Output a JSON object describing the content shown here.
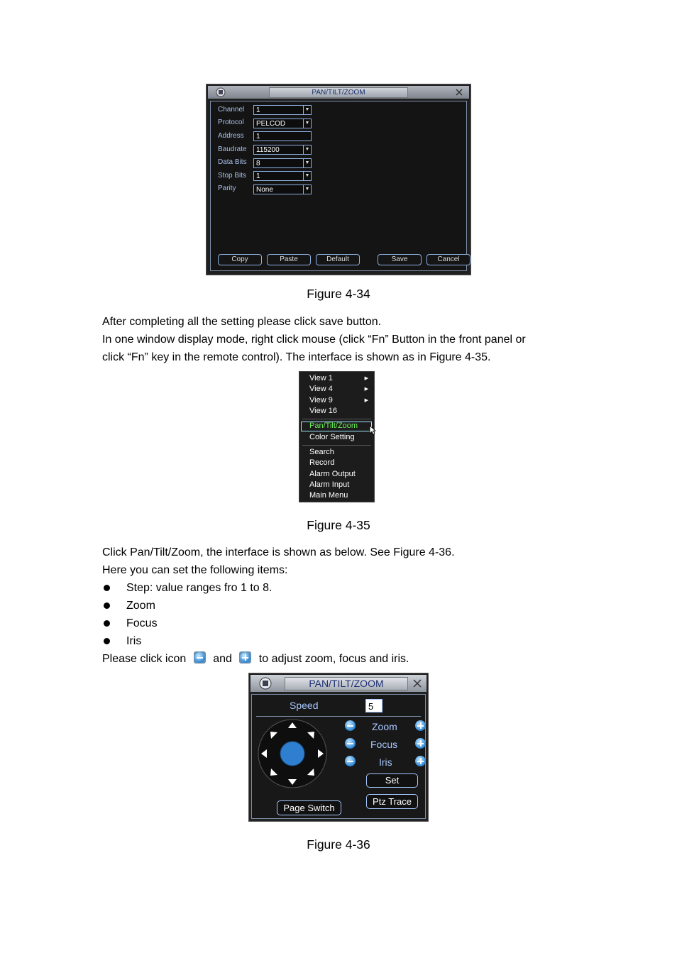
{
  "figure1": {
    "title": "PAN/TILT/ZOOM",
    "fields": [
      {
        "label": "Channel",
        "value": "1",
        "dropdown": true
      },
      {
        "label": "Protocol",
        "value": "PELCOD",
        "dropdown": true
      },
      {
        "label": "Address",
        "value": "1",
        "dropdown": false
      },
      {
        "label": "Baudrate",
        "value": "115200",
        "dropdown": true
      },
      {
        "label": "Data Bits",
        "value": "8",
        "dropdown": true
      },
      {
        "label": "Stop Bits",
        "value": "1",
        "dropdown": true
      },
      {
        "label": "Parity",
        "value": "None",
        "dropdown": true
      }
    ],
    "buttons": {
      "copy": "Copy",
      "paste": "Paste",
      "default": "Default",
      "save": "Save",
      "cancel": "Cancel"
    },
    "caption": "Figure 4-34"
  },
  "para1": "After completing all the setting please click save button.",
  "para2a": "In one window display mode, right click mouse (click “Fn” Button in the front panel or",
  "para2b": "click “Fn” key in the remote control). The interface is shown as in Figure 4-35.",
  "figure2": {
    "items": {
      "view1": "View 1",
      "view4": "View 4",
      "view9": "View 9",
      "view16": "View 16",
      "ptz": "Pan/Tilt/Zoom",
      "color": "Color Setting",
      "search": "Search",
      "record": "Record",
      "alarm_out": "Alarm Output",
      "alarm_in": "Alarm Input",
      "main_menu": "Main Menu"
    },
    "colors": {
      "selected_text": "#6ef05a"
    },
    "caption": "Figure 4-35"
  },
  "para3": "Click Pan/Tilt/Zoom, the interface is shown as below. See Figure 4-36.",
  "para4": "Here you can set the following items:",
  "bullets": [
    "Step: value ranges fro 1 to 8.",
    "Zoom",
    "Focus",
    "Iris"
  ],
  "para5": {
    "before": "Please click icon",
    "middle": "and",
    "after": "to adjust zoom, focus and iris."
  },
  "figure3": {
    "title": "PAN/TILT/ZOOM",
    "speed_label": "Speed",
    "speed_value": "5",
    "zoom": "Zoom",
    "focus": "Focus",
    "iris": "Iris",
    "set": "Set",
    "ptz_trace": "Ptz Trace",
    "page_switch": "Page Switch",
    "caption": "Figure 4-36"
  }
}
